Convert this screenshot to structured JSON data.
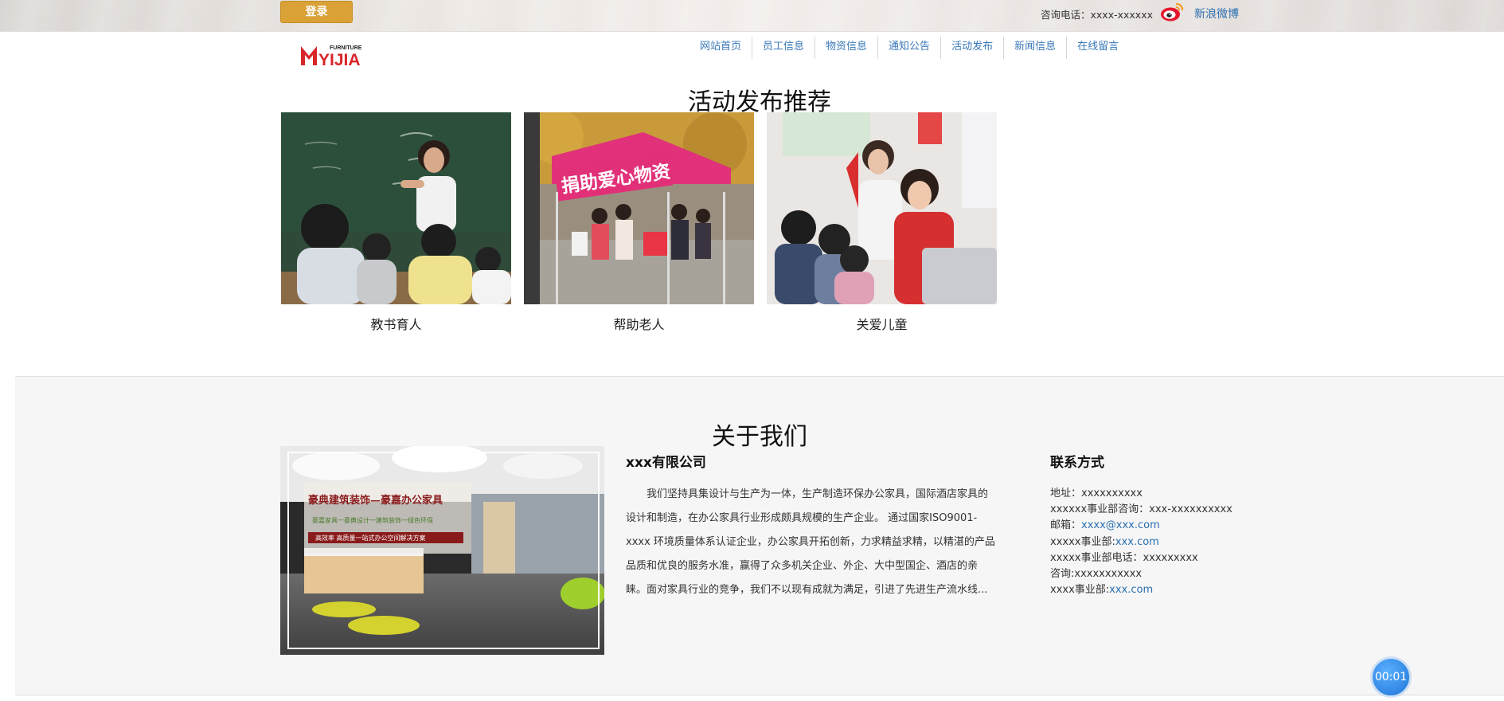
{
  "topbar": {
    "login_label": "登录",
    "phone_text": "咨询电话：xxxx-xxxxxx",
    "weibo_label": "新浪微博"
  },
  "logo": {
    "small_text": "FURNITURE",
    "brand_text": "YIJIA",
    "color": "#d8262a"
  },
  "nav": {
    "items": [
      {
        "label": "网站首页"
      },
      {
        "label": "员工信息"
      },
      {
        "label": "物资信息"
      },
      {
        "label": "通知公告"
      },
      {
        "label": "活动发布"
      },
      {
        "label": "新闻信息"
      },
      {
        "label": "在线留言"
      }
    ]
  },
  "activity": {
    "title": "活动发布推荐",
    "cards": [
      {
        "caption": "教书育人"
      },
      {
        "caption": "帮助老人",
        "banner": "捐助爱心物资"
      },
      {
        "caption": "关爱儿童"
      }
    ]
  },
  "about": {
    "title": "关于我们",
    "image_text": {
      "line1": "豪典建筑装饰—豪嘉办公家具",
      "line2": "豪嘉家具一豪典设计一建筑装饰一绿色环保",
      "line3": "高效率 高质量一站式办公空间解决方案"
    },
    "company_name": "xxx有限公司",
    "company_desc": "我们坚持具集设计与生产为一体，生产制造环保办公家具，国际酒店家具的设计和制造，在办公家具行业形成颇具规模的生产企业。 通过国家ISO9001- xxxx 环境质量体系认证企业，办公家具开拓创新，力求精益求精，以精湛的产品品质和优良的服务水准，赢得了众多机关企业、外企、大中型国企、酒店的亲睐。面对家具行业的竞争，我们不以现有成就为满足，引进了先进生产流水线...",
    "contact_title": "联系方式",
    "contacts": {
      "address": "地址：xxxxxxxxxx",
      "dept_consult": "xxxxxx事业部咨询：xxx-xxxxxxxxxx",
      "email_label": "邮箱：",
      "email_value": "xxxx@xxx.com",
      "dept1_label": "xxxxx事业部:",
      "dept1_value": "xxx.com",
      "dept_phone": "xxxxx事业部电话：xxxxxxxxx",
      "consult": "咨询:xxxxxxxxxxx",
      "dept2_label": "xxxx事业部:",
      "dept2_value": "xxx.com"
    }
  },
  "timer": {
    "label": "00:01"
  }
}
